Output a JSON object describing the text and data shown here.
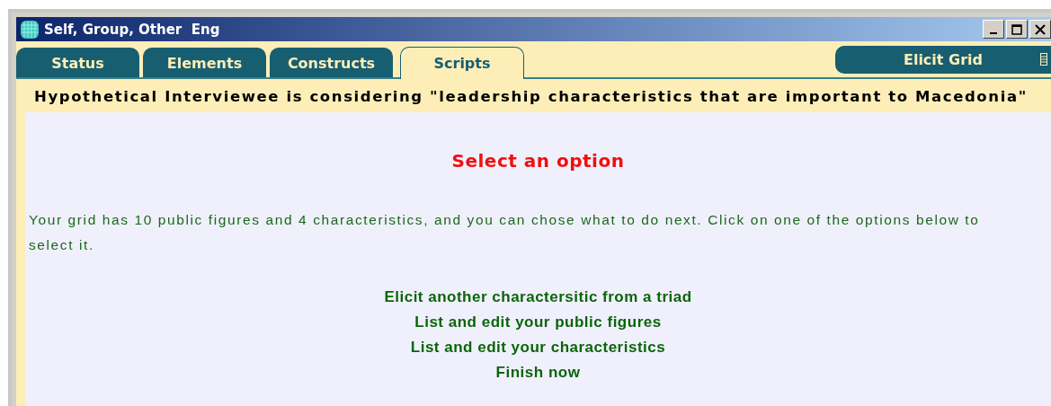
{
  "window": {
    "title": "Self, Group, Other  Eng"
  },
  "tabs": [
    {
      "label": "Status",
      "selected": false
    },
    {
      "label": "Elements",
      "selected": false
    },
    {
      "label": "Constructs",
      "selected": false
    },
    {
      "label": "Scripts",
      "selected": true
    }
  ],
  "mode_button": {
    "label": "Elicit Grid"
  },
  "header": "Hypothetical Interviewee is considering \"leadership characteristics that are important to Macedonia\"",
  "content": {
    "heading": "Select an option",
    "message": "Your grid has 10 public figures and 4 characteristics, and you can chose what to do next. Click on one of the options below to select it.",
    "options": [
      "Elicit another charactersitic from a triad",
      "List and edit your public figures",
      "List and edit your characteristics",
      "Finish now"
    ]
  }
}
